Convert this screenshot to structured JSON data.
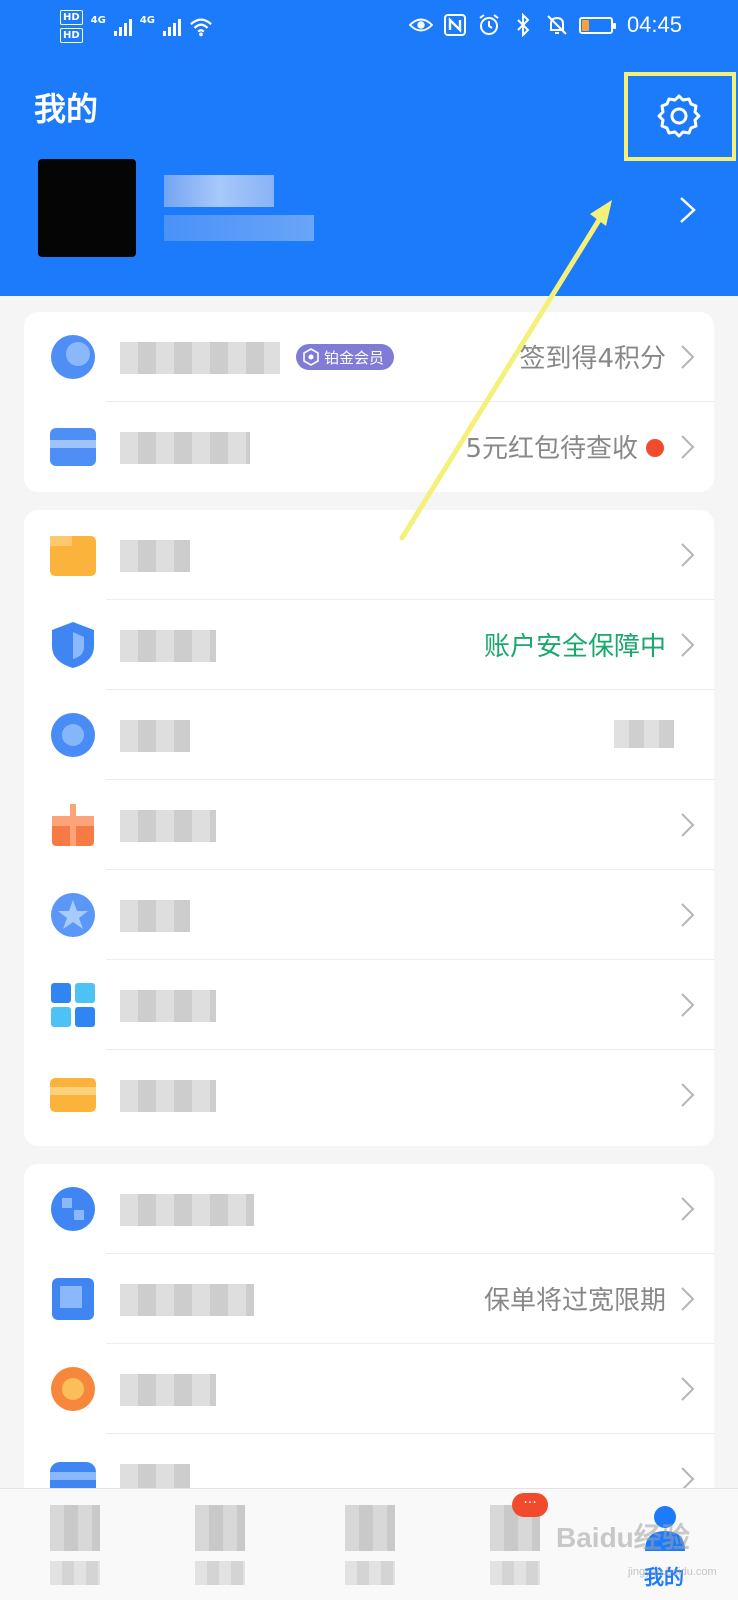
{
  "status_bar": {
    "time": "04:45",
    "network_1": "4G",
    "network_2": "4G",
    "hd_1": "HD",
    "hd_2": "HD"
  },
  "header": {
    "title": "我的"
  },
  "colors": {
    "brand_blue": "#1b7bfa",
    "highlight_yellow": "#f5f07a",
    "safe_green": "#19a86b",
    "red_dot": "#f24a2c",
    "badge_purple": "#7f7bd6"
  },
  "card1": {
    "rows": [
      {
        "icon": "member-icon",
        "badge": "铂金会员",
        "value": "签到得4积分"
      },
      {
        "icon": "wallet-icon",
        "value": "5元红包待查收"
      }
    ]
  },
  "card2": {
    "rows": [
      {
        "icon": "folder-icon",
        "value": ""
      },
      {
        "icon": "shield-icon",
        "value": "账户安全保障中"
      },
      {
        "icon": "service-icon",
        "value": ""
      },
      {
        "icon": "gift-icon",
        "value": ""
      },
      {
        "icon": "star-icon",
        "value": ""
      },
      {
        "icon": "grid-icon",
        "value": ""
      },
      {
        "icon": "card-icon",
        "value": ""
      }
    ]
  },
  "card3": {
    "rows": [
      {
        "icon": "chart-icon",
        "value": ""
      },
      {
        "icon": "insurance-icon",
        "value": "保单将过宽限期"
      },
      {
        "icon": "coupon-icon",
        "value": ""
      },
      {
        "icon": "bank-icon",
        "value": ""
      }
    ]
  },
  "bottom_nav": {
    "active_label": "我的",
    "message_badge": "···"
  },
  "watermark": {
    "text": "Baidu经验",
    "sub": "jingyan.baidu.com"
  }
}
